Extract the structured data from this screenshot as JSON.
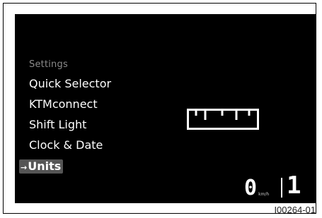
{
  "menu": {
    "heading": "Settings",
    "items": [
      {
        "label": "Quick Selector"
      },
      {
        "label": "KTMconnect"
      },
      {
        "label": "Shift Light"
      },
      {
        "label": "Clock & Date"
      }
    ],
    "selected": {
      "label": "Units",
      "indicator": "→"
    }
  },
  "icons": {
    "units_icon": "ruler-icon"
  },
  "status": {
    "speed": "0",
    "speed_unit": "km/h",
    "gear": "1"
  },
  "figure_id": "I00264-01",
  "colors": {
    "screen_bg": "#000000",
    "text": "#ffffff",
    "heading": "#8a8a8a",
    "selection_bg": "#555555"
  }
}
